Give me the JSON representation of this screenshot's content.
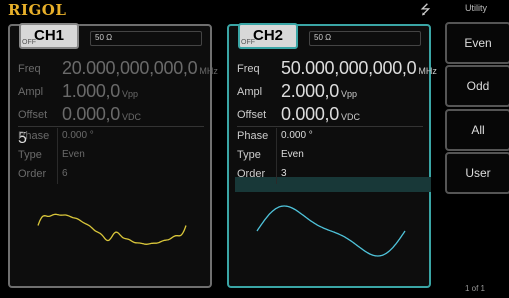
{
  "topbar": {
    "logo": "RIGOL",
    "usb_icon": "usb-icon",
    "menu_title": "Utility"
  },
  "ch1": {
    "title": "CH1",
    "state": "OFF",
    "impedance": "50 Ω",
    "freq": {
      "label": "Freq",
      "value": "20.000,000,000,0",
      "unit": "MHz"
    },
    "ampl": {
      "label": "Ampl",
      "value": "1.000,0",
      "unit": "Vpp"
    },
    "offset": {
      "label": "Offset",
      "value": "0.000,0",
      "unit": "VDC"
    },
    "phase": {
      "label": "Phase",
      "value": "0.000 °"
    },
    "type": {
      "label": "Type",
      "value": "Even"
    },
    "order": {
      "label": "Order",
      "value": "6"
    },
    "wave_color": "#d9c63a"
  },
  "ch2": {
    "title": "CH2",
    "state": "OFF",
    "impedance": "50 Ω",
    "freq": {
      "label": "Freq",
      "value": "50.000,000,000,0",
      "unit": "MHz"
    },
    "ampl": {
      "label": "Ampl",
      "value": "2.000,0",
      "unit": "Vpp"
    },
    "offset": {
      "label": "Offset",
      "value": "0.000,0",
      "unit": "VDC"
    },
    "phase": {
      "label": "Phase",
      "value": "0.000 °"
    },
    "type": {
      "label": "Type",
      "value": "Even"
    },
    "order": {
      "label": "Order",
      "value": "3"
    },
    "wave_color": "#4fc3da"
  },
  "menu": {
    "buttons": [
      "Even",
      "Odd",
      "All",
      "User"
    ],
    "pager": "1 of 1"
  }
}
